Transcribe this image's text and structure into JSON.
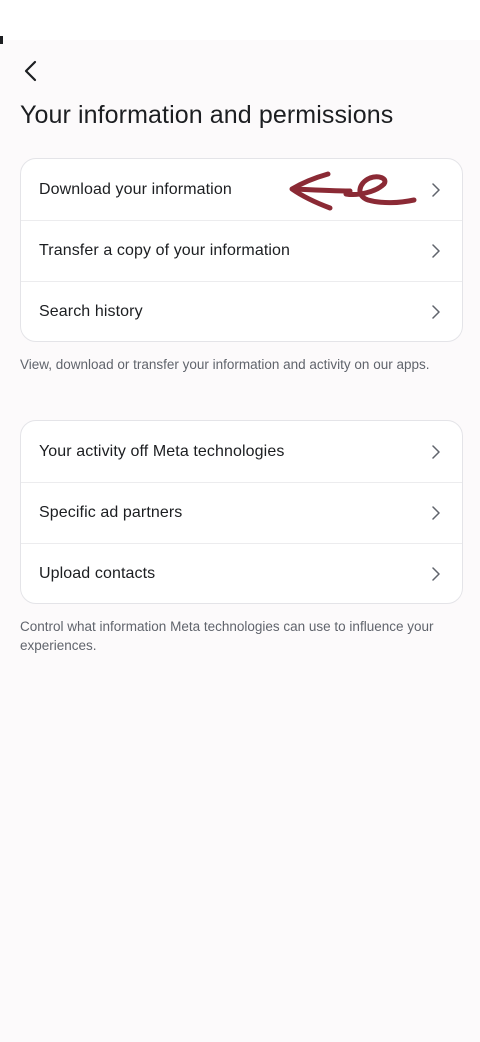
{
  "header": {
    "back_icon": "chevron-left-icon",
    "title": "Your information and permissions"
  },
  "section_1": {
    "items": [
      {
        "label": "Download your information",
        "icon": "chevron-right-icon"
      },
      {
        "label": "Transfer a copy of your information",
        "icon": "chevron-right-icon"
      },
      {
        "label": "Search history",
        "icon": "chevron-right-icon"
      }
    ],
    "caption": "View, download or transfer your information and activity on our apps."
  },
  "section_2": {
    "items": [
      {
        "label": "Your activity off Meta technologies",
        "icon": "chevron-right-icon"
      },
      {
        "label": "Specific ad partners",
        "icon": "chevron-right-icon"
      },
      {
        "label": "Upload contacts",
        "icon": "chevron-right-icon"
      }
    ],
    "caption": "Control what information Meta technologies can use to influence your experiences."
  },
  "annotation": {
    "type": "handwritten-arrow",
    "color": "#8b2a35"
  },
  "colors": {
    "background": "#fcfafb",
    "card": "#ffffff",
    "text": "#1c1e21",
    "secondary_text": "#60646c",
    "divider": "#ececee"
  }
}
